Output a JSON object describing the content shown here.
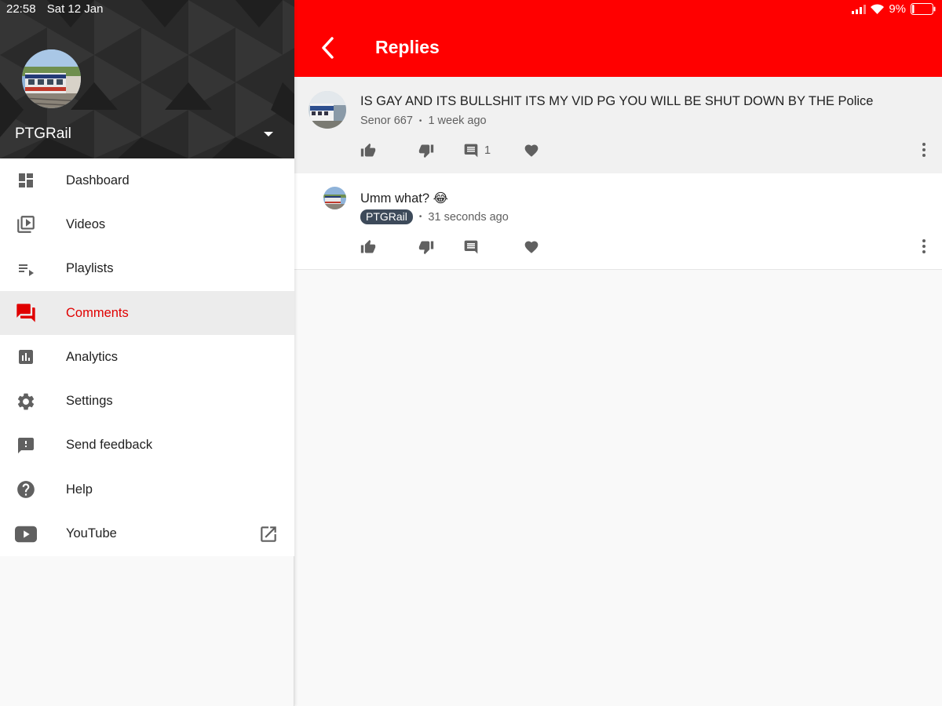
{
  "status_bar": {
    "time": "22:58",
    "date": "Sat 12 Jan",
    "battery": "9%"
  },
  "sidebar": {
    "channel_name": "PTGRail",
    "items": [
      {
        "label": "Dashboard",
        "icon": "dashboard-icon"
      },
      {
        "label": "Videos",
        "icon": "video-library-icon"
      },
      {
        "label": "Playlists",
        "icon": "playlist-icon"
      },
      {
        "label": "Comments",
        "icon": "comments-icon",
        "active": true
      },
      {
        "label": "Analytics",
        "icon": "analytics-icon"
      },
      {
        "label": "Settings",
        "icon": "gear-icon"
      },
      {
        "label": "Send feedback",
        "icon": "feedback-icon"
      },
      {
        "label": "Help",
        "icon": "help-icon"
      },
      {
        "label": "YouTube",
        "icon": "youtube-icon",
        "external": true
      }
    ]
  },
  "header": {
    "title": "Replies"
  },
  "comments": {
    "parent": {
      "text": "IS  GAY AND ITS BULLSHIT ITS MY VID PG YOU WILL BE SHUT DOWN BY THE Police",
      "author": "Senor 667",
      "time": "1 week ago",
      "reply_count": "1"
    },
    "reply": {
      "text": "Umm what? 😂",
      "author": "PTGRail",
      "time": "31 seconds ago"
    }
  },
  "colors": {
    "brand_red": "#ff0000",
    "active_red": "#e00000",
    "badge": "#3d4a5a"
  }
}
